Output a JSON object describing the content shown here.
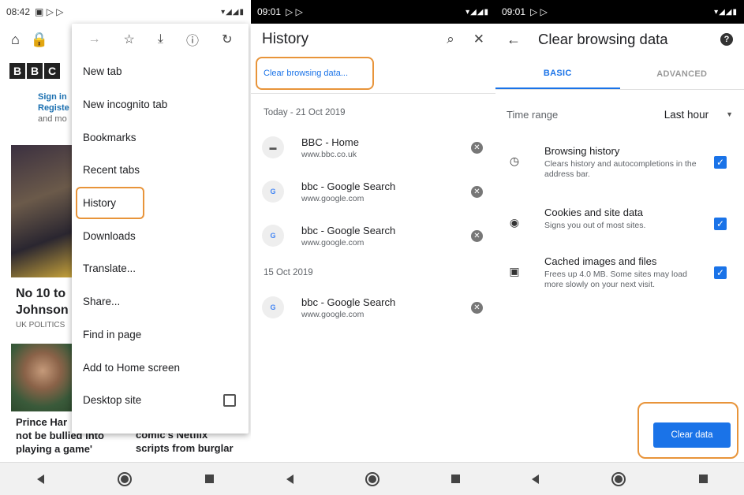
{
  "panel1": {
    "status": {
      "time": "08:42",
      "icons": "▾◢◢▮"
    },
    "page": {
      "logo_letters": [
        "B",
        "B",
        "C"
      ],
      "sign_in": "Sign in",
      "register": "Registe",
      "and_more": "and mo",
      "headline_line1": "No 10 to",
      "headline_line2": "Johnson",
      "tag": "UK POLITICS",
      "story1_line1": "Prince Har",
      "story1_line2": "not be bullied into",
      "story1_line3": "playing a game'",
      "story2_line1": "comic's Netflix",
      "story2_line2": "scripts from burglar"
    },
    "menu": {
      "items": [
        {
          "label": "New tab"
        },
        {
          "label": "New incognito tab"
        },
        {
          "label": "Bookmarks"
        },
        {
          "label": "Recent tabs"
        },
        {
          "label": "History"
        },
        {
          "label": "Downloads"
        },
        {
          "label": "Translate..."
        },
        {
          "label": "Share..."
        },
        {
          "label": "Find in page"
        },
        {
          "label": "Add to Home screen"
        },
        {
          "label": "Desktop site"
        }
      ]
    }
  },
  "panel2": {
    "status": {
      "time": "09:01",
      "icons": "▾◢◢▮"
    },
    "title": "History",
    "clear_link": "Clear browsing data...",
    "sections": [
      {
        "date": "Today - 21 Oct 2019",
        "items": [
          {
            "title": "BBC - Home",
            "url": "www.bbc.co.uk",
            "fav": "BBC"
          },
          {
            "title": "bbc - Google Search",
            "url": "www.google.com",
            "fav": "G"
          },
          {
            "title": "bbc - Google Search",
            "url": "www.google.com",
            "fav": "G"
          }
        ]
      },
      {
        "date": "15 Oct 2019",
        "items": [
          {
            "title": "bbc - Google Search",
            "url": "www.google.com",
            "fav": "G"
          }
        ]
      }
    ]
  },
  "panel3": {
    "status": {
      "time": "09:01",
      "icons": "▾◢◢▮"
    },
    "title": "Clear browsing data",
    "tabs": {
      "basic": "BASIC",
      "advanced": "ADVANCED"
    },
    "time_range": {
      "label": "Time range",
      "value": "Last hour"
    },
    "options": [
      {
        "title": "Browsing history",
        "desc": "Clears history and autocompletions in the address bar.",
        "checked": true
      },
      {
        "title": "Cookies and site data",
        "desc": "Signs you out of most sites.",
        "checked": true
      },
      {
        "title": "Cached images and files",
        "desc": "Frees up 4.0 MB. Some sites may load more slowly on your next visit.",
        "checked": true
      }
    ],
    "clear_button": "Clear data"
  },
  "colors": {
    "accent": "#1a73e8",
    "highlight": "#e8943a"
  }
}
